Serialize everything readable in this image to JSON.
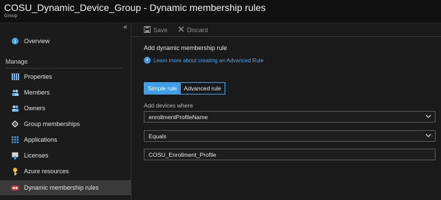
{
  "header": {
    "title": "COSU_Dynamic_Device_Group - Dynamic membership rules",
    "subtitle": "Group"
  },
  "sidebar": {
    "collapse": "«",
    "overview": "Overview",
    "section": "Manage",
    "items": [
      {
        "label": "Properties",
        "icon": "properties-icon"
      },
      {
        "label": "Members",
        "icon": "members-icon"
      },
      {
        "label": "Owners",
        "icon": "owners-icon"
      },
      {
        "label": "Group memberships",
        "icon": "gear-icon"
      },
      {
        "label": "Applications",
        "icon": "applications-icon"
      },
      {
        "label": "Licenses",
        "icon": "licenses-icon"
      },
      {
        "label": "Azure resources",
        "icon": "key-icon"
      },
      {
        "label": "Dynamic membership rules",
        "icon": "dynamic-rules-icon",
        "active": true
      }
    ]
  },
  "toolbar": {
    "save": "Save",
    "discard": "Discard"
  },
  "main": {
    "heading": "Add dynamic membership rule",
    "learn_link": "Learn more about creating an Advanced Rule",
    "tabs": [
      "Simple rule",
      "Advanced rule"
    ],
    "add_label": "Add devices where",
    "property": "enrollmentProfileName",
    "operator": "Equals",
    "value": "COSU_Enrollment_Profile"
  },
  "colors": {
    "accent": "#3b9ee6",
    "link": "#4aa5ef",
    "background": "#1a1a1a"
  }
}
